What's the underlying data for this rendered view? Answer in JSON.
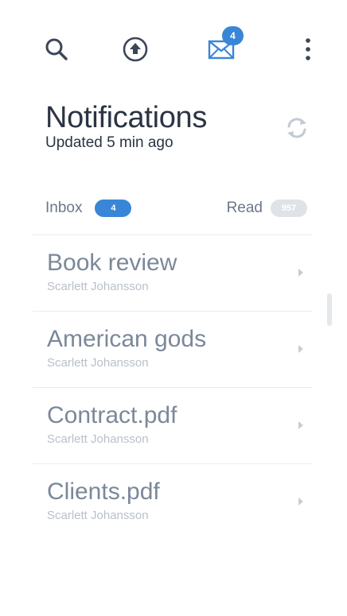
{
  "toolbar": {
    "icons": [
      "search-icon",
      "upload-icon",
      "mail-icon",
      "more-vertical-icon"
    ],
    "mail_badge": "4",
    "accent_color": "#3a86d6"
  },
  "header": {
    "title": "Notifications",
    "subtitle": "Updated 5 min ago"
  },
  "tabs": {
    "inbox_label": "Inbox",
    "inbox_count": "4",
    "read_label": "Read",
    "read_count": "957"
  },
  "items": [
    {
      "title": "Book review",
      "author": "Scarlett Johansson"
    },
    {
      "title": "American gods",
      "author": "Scarlett Johansson"
    },
    {
      "title": "Contract.pdf",
      "author": "Scarlett Johansson"
    },
    {
      "title": "Clients.pdf",
      "author": "Scarlett Johansson"
    }
  ]
}
